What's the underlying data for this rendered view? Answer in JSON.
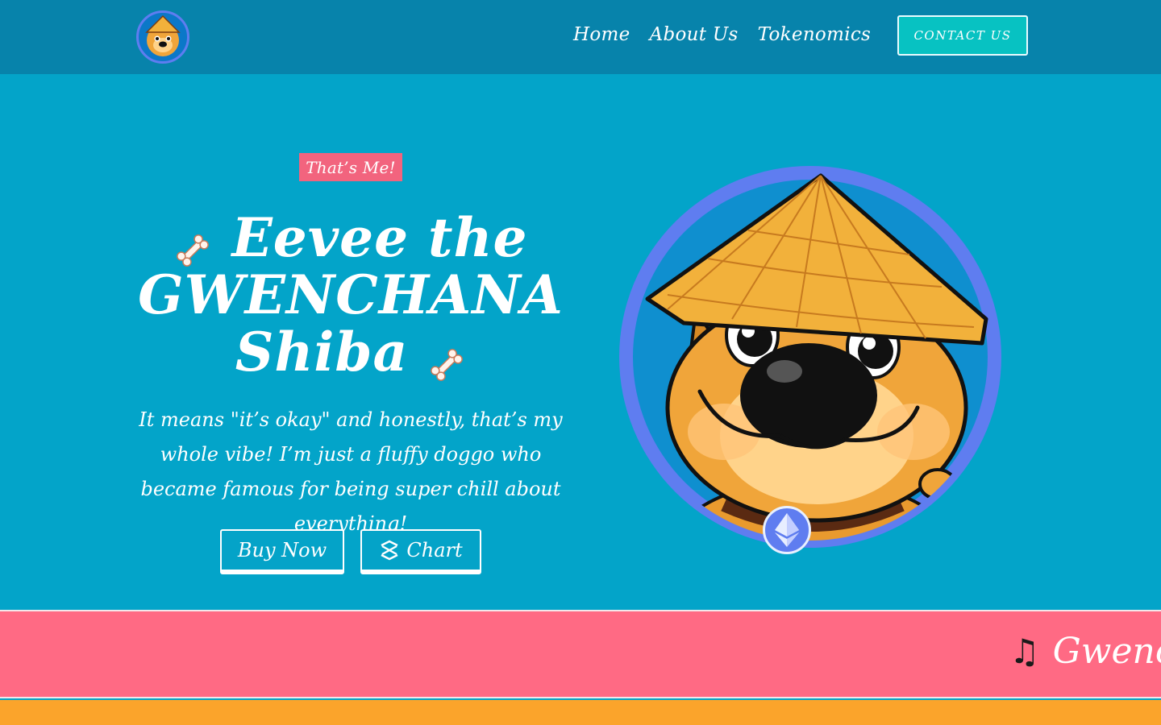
{
  "navbar": {
    "logo_icon": "shiba-dog-logo-icon",
    "links": [
      {
        "label": "Home"
      },
      {
        "label": "About Us"
      },
      {
        "label": "Tokenomics"
      }
    ],
    "contact_label": "CONTACT US"
  },
  "hero": {
    "badge": "That’s Me!",
    "title_line1": "Eevee the",
    "title_line2": "GWENCHANA",
    "title_line3": "Shiba",
    "description": "It means \"it’s okay\" and honestly, that’s my whole vibe! I’m just a fluffy doggo who became famous for being super chill about everything!",
    "buy_label": "Buy Now",
    "chart_label": "Chart"
  },
  "marquee": {
    "icon": "music-note-icon",
    "text": "Gwencha"
  },
  "colors": {
    "navbar_bg": "#0783ab",
    "hero_bg": "#03a4c9",
    "accent_teal": "#07c2c2",
    "badge_pink": "#f2647e",
    "marquee_pink": "#ff6a84",
    "ring_blue": "#5f7df0",
    "band_orange": "#fba42b"
  }
}
